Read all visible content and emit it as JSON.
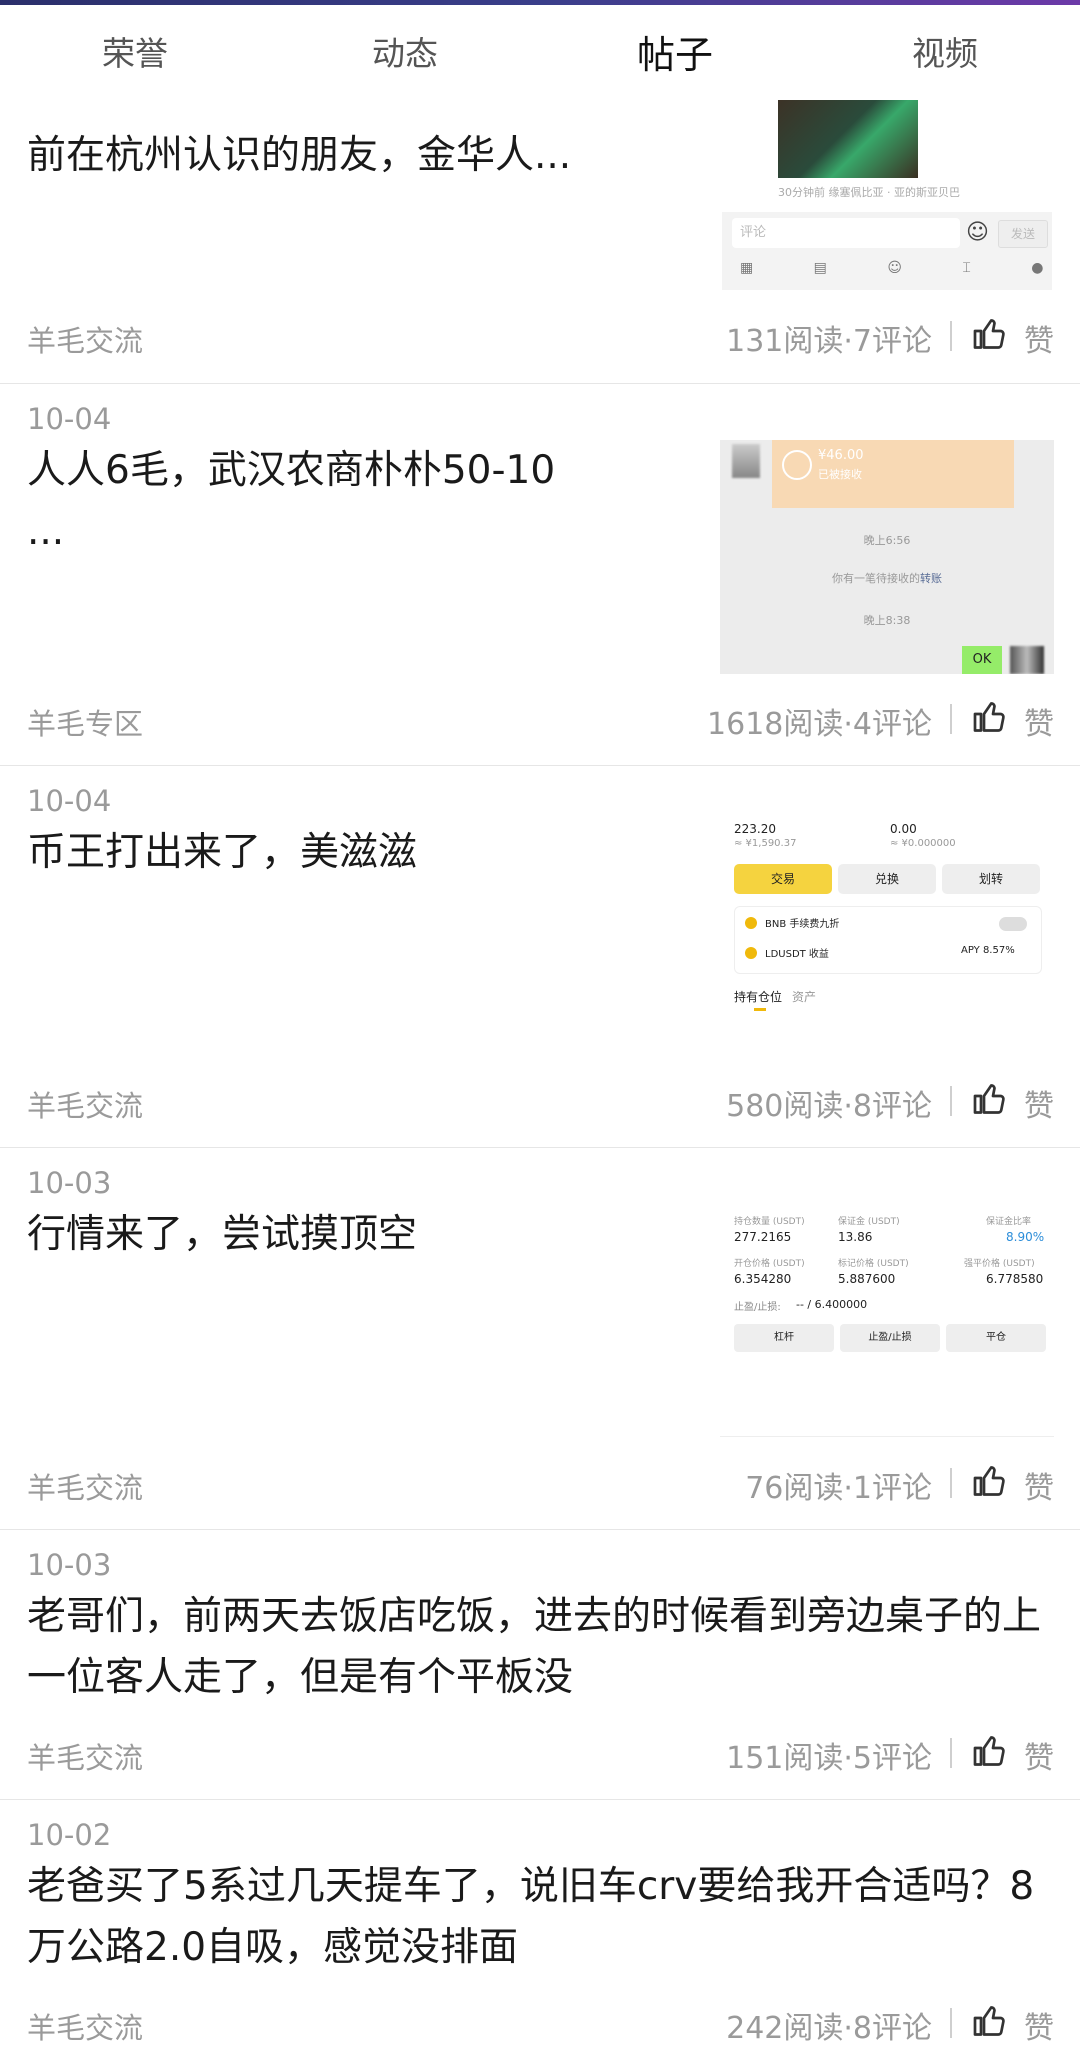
{
  "tabs": [
    {
      "label": "荣誉",
      "active": false
    },
    {
      "label": "动态",
      "active": false
    },
    {
      "label": "帖子",
      "active": true
    },
    {
      "label": "视频",
      "active": false
    }
  ],
  "like_label": "赞",
  "posts": [
    {
      "date": "",
      "title": "前在杭州认识的朋友，金华人...",
      "category": "羊毛交流",
      "stats": "131阅读·7评论",
      "thumb": {
        "meta": "30分钟前  缘塞佩比亚 · 亚的斯亚贝巴",
        "comment_placeholder": "评论",
        "send": "发送"
      }
    },
    {
      "date": "10-04",
      "title": "人人6毛，武汉农商朴朴50-10\n...",
      "category": "羊毛专区",
      "stats": "1618阅读·4评论",
      "thumb": {
        "amount": "¥46.00",
        "status": "已被接收",
        "time1": "晚上6:56",
        "notice": "你有一笔待接收的",
        "notice_link": "转账",
        "time2": "晚上8:38",
        "ok": "OK"
      }
    },
    {
      "date": "10-04",
      "title": "币王打出来了，美滋滋",
      "category": "羊毛交流",
      "stats": "580阅读·8评论",
      "thumb": {
        "val1": "223.20",
        "sub1": "≈ ¥1,590.37",
        "val2": "0.00",
        "sub2": "≈ ¥0.000000",
        "btn1": "交易",
        "btn2": "兑换",
        "btn3": "划转",
        "row1": "BNB 手续费九折",
        "row2": "LDUSDT 收益",
        "apy": "APY 8.57%",
        "tab1": "持有仓位",
        "tab2": "资产"
      }
    },
    {
      "date": "10-03",
      "title": "行情来了，尝试摸顶空",
      "category": "羊毛交流",
      "stats": "76阅读·1评论",
      "thumb": {
        "h1": "持仓数量 (USDT)",
        "h2": "保证金 (USDT)",
        "h3": "保证金比率",
        "v1": "277.2165",
        "v2": "13.86",
        "v3": "8.90%",
        "h4": "开仓价格 (USDT)",
        "h5": "标记价格 (USDT)",
        "h6": "强平价格 (USDT)",
        "v4": "6.354280",
        "v5": "5.887600",
        "v6": "6.778580",
        "sl_label": "止盈/止损:",
        "sl_value": "-- / 6.400000",
        "b1": "杠杆",
        "b2": "止盈/止损",
        "b3": "平仓"
      }
    },
    {
      "date": "10-03",
      "title": "老哥们，前两天去饭店吃饭，进去的时候看到旁边桌子的上一位客人走了，但是有个平板没",
      "category": "羊毛交流",
      "stats": "151阅读·5评论"
    },
    {
      "date": "10-02",
      "title": "老爸买了5系过几天提车了，说旧车crv要给我开合适吗？8万公路2.0自吸，感觉没排面",
      "category": "羊毛交流",
      "stats": "242阅读·8评论"
    }
  ]
}
